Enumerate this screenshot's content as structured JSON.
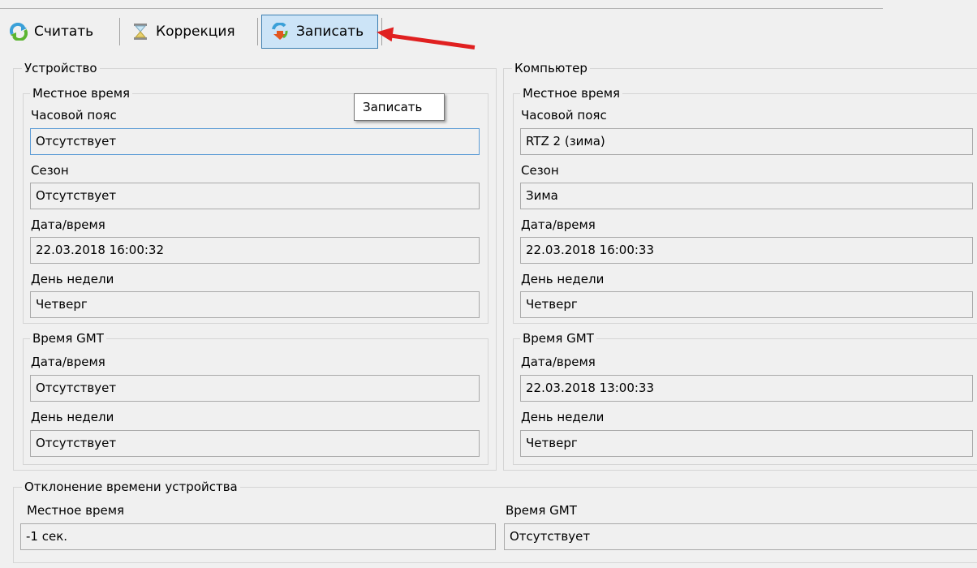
{
  "toolbar": {
    "read_label": "Считать",
    "correction_label": "Коррекция",
    "write_label": "Записать"
  },
  "tooltip": "Записать",
  "device": {
    "title": "Устройство",
    "local": {
      "title": "Местное время",
      "timezone_label": "Часовой пояс",
      "timezone_value": "Отсутствует",
      "season_label": "Сезон",
      "season_value": "Отсутствует",
      "datetime_label": "Дата/время",
      "datetime_value": "22.03.2018 16:00:32",
      "weekday_label": "День недели",
      "weekday_value": "Четверг"
    },
    "gmt": {
      "title": "Время GMT",
      "datetime_label": "Дата/время",
      "datetime_value": "Отсутствует",
      "weekday_label": "День недели",
      "weekday_value": "Отсутствует"
    }
  },
  "computer": {
    "title": "Компьютер",
    "local": {
      "title": "Местное время",
      "timezone_label": "Часовой пояс",
      "timezone_value": "RTZ 2 (зима)",
      "season_label": "Сезон",
      "season_value": "Зима",
      "datetime_label": "Дата/время",
      "datetime_value": "22.03.2018 16:00:33",
      "weekday_label": "День недели",
      "weekday_value": "Четверг"
    },
    "gmt": {
      "title": "Время GMT",
      "datetime_label": "Дата/время",
      "datetime_value": "22.03.2018 13:00:33",
      "weekday_label": "День недели",
      "weekday_value": "Четверг"
    }
  },
  "deviation": {
    "title": "Отклонение времени устройства",
    "local_label": "Местное время",
    "local_value": "-1 сек.",
    "gmt_label": "Время GMT",
    "gmt_value": "Отсутствует"
  },
  "colors": {
    "annotation_arrow": "#e02020",
    "active_button_bg": "#cce4f7",
    "active_button_border": "#3c7fb1"
  },
  "icons": {
    "read": "read-refresh-icon",
    "correction": "hourglass-icon",
    "write": "write-icon"
  }
}
